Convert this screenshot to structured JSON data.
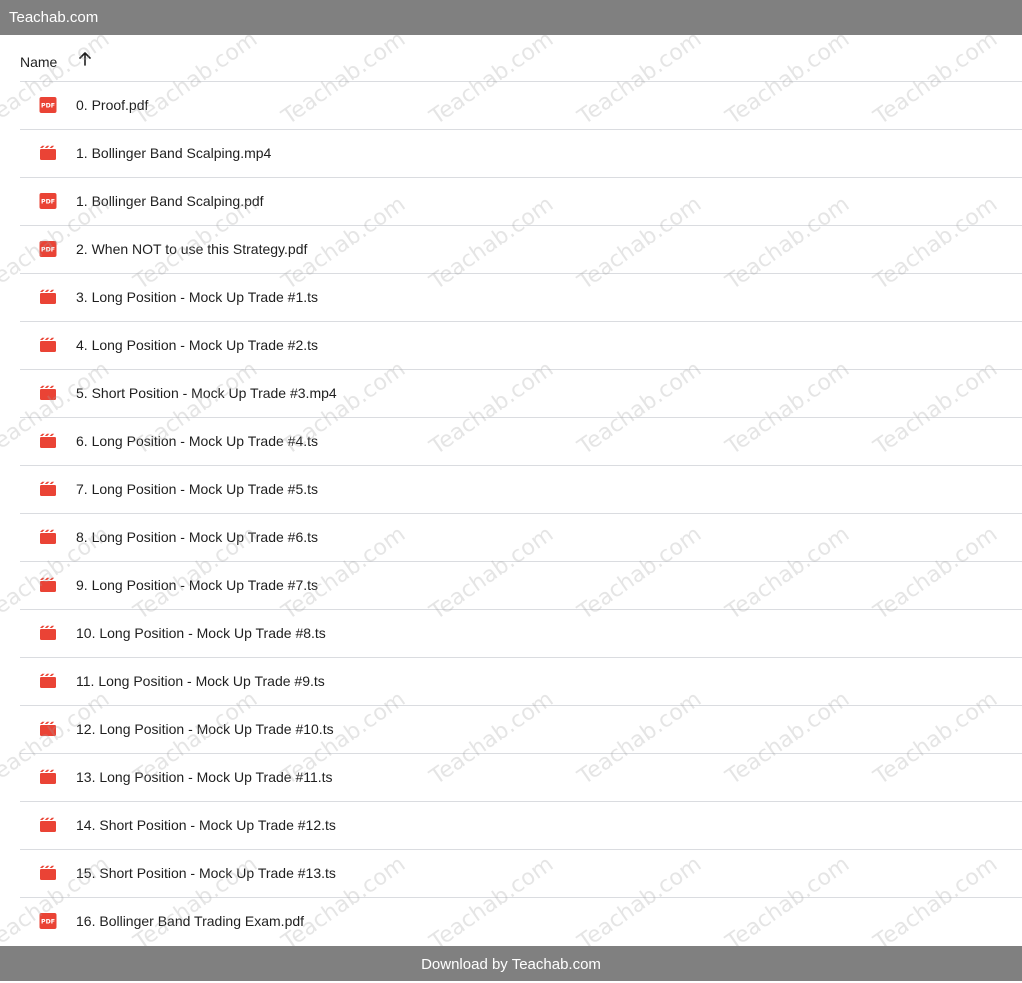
{
  "header": {
    "title": "Teachab.com"
  },
  "list_header": {
    "name_label": "Name",
    "sort_icon": "arrow-up-icon"
  },
  "files": [
    {
      "name": "0. Proof.pdf",
      "type": "pdf"
    },
    {
      "name": "1. Bollinger Band Scalping.mp4",
      "type": "video"
    },
    {
      "name": "1. Bollinger Band Scalping.pdf",
      "type": "pdf"
    },
    {
      "name": "2. When NOT to use this Strategy.pdf",
      "type": "pdf"
    },
    {
      "name": "3. Long Position - Mock Up Trade #1.ts",
      "type": "video"
    },
    {
      "name": "4. Long Position - Mock Up Trade #2.ts",
      "type": "video"
    },
    {
      "name": "5. Short Position - Mock Up Trade #3.mp4",
      "type": "video"
    },
    {
      "name": "6. Long Position - Mock Up Trade #4.ts",
      "type": "video"
    },
    {
      "name": "7. Long Position - Mock Up Trade #5.ts",
      "type": "video"
    },
    {
      "name": "8. Long Position - Mock Up Trade #6.ts",
      "type": "video"
    },
    {
      "name": "9. Long Position - Mock Up Trade #7.ts",
      "type": "video"
    },
    {
      "name": "10. Long Position - Mock Up Trade #8.ts",
      "type": "video"
    },
    {
      "name": "11. Long Position - Mock Up Trade #9.ts",
      "type": "video"
    },
    {
      "name": "12. Long Position - Mock Up Trade #10.ts",
      "type": "video"
    },
    {
      "name": "13. Long Position - Mock Up Trade #11.ts",
      "type": "video"
    },
    {
      "name": "14. Short Position - Mock Up Trade #12.ts",
      "type": "video"
    },
    {
      "name": "15. Short Position - Mock Up Trade #13.ts",
      "type": "video"
    },
    {
      "name": "16. Bollinger Band Trading Exam.pdf",
      "type": "pdf"
    }
  ],
  "footer": {
    "text": "Download by Teachab.com"
  },
  "watermark": {
    "text": "Teachab.com"
  },
  "colors": {
    "bar": "#808080",
    "icon_red": "#ea4335",
    "divider": "#dadce0"
  },
  "icons": {
    "pdf": "pdf-file-icon",
    "video": "video-file-icon"
  }
}
